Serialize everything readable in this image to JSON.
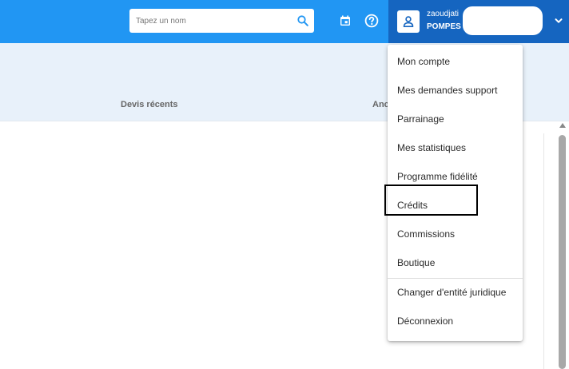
{
  "search": {
    "placeholder": "Tapez un nom"
  },
  "user": {
    "name": "zaoudjati",
    "company": "POMPES"
  },
  "tabs": [
    {
      "label": "Devis récents"
    },
    {
      "label": "Anc"
    }
  ],
  "menu": {
    "items": [
      {
        "label": "Mon compte"
      },
      {
        "label": "Mes demandes support"
      },
      {
        "label": "Parrainage"
      },
      {
        "label": "Mes statistiques"
      },
      {
        "label": "Programme fidélité"
      },
      {
        "label": "Crédits"
      },
      {
        "label": "Commissions"
      },
      {
        "label": "Boutique"
      },
      {
        "label": "Changer d'entité juridique"
      },
      {
        "label": "Déconnexion"
      }
    ]
  },
  "colors": {
    "topbar": "#2196f3",
    "user_area": "#1565c0",
    "subheader": "#e8f1fa"
  },
  "icons": {
    "search": "search-icon",
    "calendar": "calendar-icon",
    "help": "help-icon",
    "avatar": "user-icon",
    "chevron": "chevron-down-icon"
  }
}
